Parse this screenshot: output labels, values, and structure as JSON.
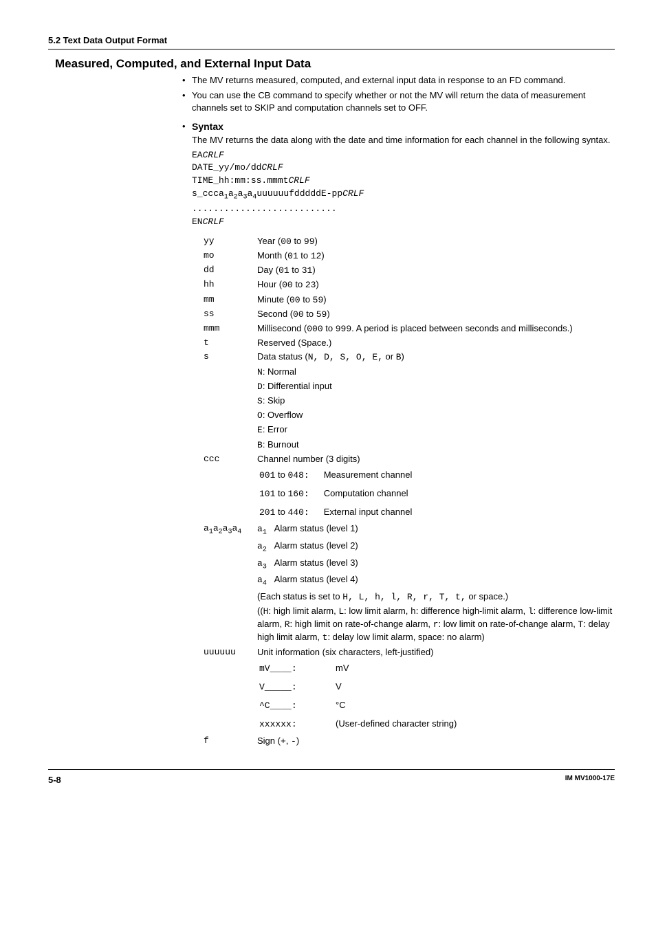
{
  "section_header": "5.2  Text Data Output Format",
  "subsection_title": "Measured, Computed, and External Input Data",
  "bullets": [
    "The MV returns measured, computed, and external input data in response to an FD command.",
    "You can use the CB command to specify whether or not the MV will return the data of measurement channels set to SKIP and computation channels set to OFF."
  ],
  "syntax": {
    "title": "Syntax",
    "intro": "The MV returns the data along with the date and time information for each channel in the following syntax.",
    "lines": {
      "l1a": "EA",
      "l1b": "CRLF",
      "l2a": "DATE_yy/mo/dd",
      "l2b": "CRLF",
      "l3a": "TIME_hh:mm:ss.mmmt",
      "l3b": "CRLF",
      "l4a": "s_ccca",
      "l4b": "a",
      "l4c": "a",
      "l4d": "a",
      "l4e": "uuuuuufdddddE-pp",
      "l4f": "CRLF",
      "l5": "...........................",
      "l6a": "EN",
      "l6b": "CRLF"
    }
  },
  "defs": {
    "yy": {
      "k": "yy",
      "pre": "Year (",
      "r0": "00",
      "mid": " to ",
      "r1": "99",
      "post": ")"
    },
    "mo": {
      "k": "mo",
      "pre": "Month (",
      "r0": "01",
      "mid": " to ",
      "r1": "12",
      "post": ")"
    },
    "dd": {
      "k": "dd",
      "pre": "Day (",
      "r0": "01",
      "mid": " to ",
      "r1": "31",
      "post": ")"
    },
    "hh": {
      "k": "hh",
      "pre": "Hour (",
      "r0": "00",
      "mid": " to ",
      "r1": "23",
      "post": ")"
    },
    "mm": {
      "k": "mm",
      "pre": "Minute (",
      "r0": "00",
      "mid": " to ",
      "r1": "59",
      "post": ")"
    },
    "ss": {
      "k": "ss",
      "pre": "Second (",
      "r0": "00",
      "mid": " to ",
      "r1": "59",
      "post": ")"
    },
    "mmm": {
      "k": "mmm",
      "pre": "Millisecond (",
      "r0": "000",
      "mid": " to ",
      "r1": "999",
      "post": ". A period is placed between seconds and milliseconds.)"
    },
    "t": {
      "k": "t",
      "text": "Reserved (Space.)"
    },
    "s": {
      "k": "s",
      "head_pre": "Data status (",
      "head_codes": "N, D, S, O, E,",
      "head_or": " or ",
      "head_last": "B",
      "head_post": ")",
      "n": {
        "c": "N",
        "t": ": Normal"
      },
      "d": {
        "c": "D",
        "t": ": Differential input"
      },
      "ss": {
        "c": "S",
        "t": ": Skip"
      },
      "o": {
        "c": "O",
        "t": ": Overflow"
      },
      "e": {
        "c": "E",
        "t": ": Error"
      },
      "b": {
        "c": "B",
        "t": ": Burnout"
      }
    },
    "ccc": {
      "k": "ccc",
      "head": "Channel number (3 digits)",
      "r1": {
        "a": "001",
        "mid": " to ",
        "b": "048",
        "colon": ":",
        "t": "Measurement channel"
      },
      "r2": {
        "a": "101",
        "mid": " to ",
        "b": "160",
        "colon": ":",
        "t": "Computation channel"
      },
      "r3": {
        "a": "201",
        "mid": " to ",
        "b": "440",
        "colon": ":",
        "t": "External input channel"
      }
    },
    "alarm": {
      "k_a": "a",
      "k_1": "1",
      "k_2": "2",
      "k_3": "3",
      "k_4": "4",
      "a1c": "a",
      "a1s": "1",
      "a1t": "Alarm status (level 1)",
      "a2c": "a",
      "a2s": "2",
      "a2t": "Alarm status (level 2)",
      "a3c": "a",
      "a3s": "3",
      "a3t": "Alarm status (level 3)",
      "a4c": "a",
      "a4s": "4",
      "a4t": "Alarm status (level 4)",
      "each_pre": "(Each status is set to ",
      "each_codes": "H, L, h, l, R, r, T, t,",
      "each_post": " or space.)",
      "expl_open": "((",
      "expl_H": "H",
      "expl_Ht": ": high limit alarm, ",
      "expl_L": "L",
      "expl_Lt": ": low limit alarm, ",
      "expl_h": "h",
      "expl_ht": ": difference high-limit alarm, ",
      "expl_l": "l",
      "expl_lt": ": difference low-limit alarm, ",
      "expl_R": "R",
      "expl_Rt": ": high limit on rate-of-change alarm, ",
      "expl_r": "r",
      "expl_rt": ": low limit on rate-of-change alarm, ",
      "expl_T": "T",
      "expl_Tt": ": delay high limit alarm, ",
      "expl_t": "t",
      "expl_tt": ": delay low limit alarm, space: no alarm)"
    },
    "uu": {
      "k": "uuuuuu",
      "head": "Unit information (six characters, left-justified)",
      "r1": {
        "c": "mV____",
        "colon": ":",
        "t": "mV"
      },
      "r2": {
        "c": "V_____",
        "colon": ":",
        "t": "V"
      },
      "r3": {
        "c": "^C____",
        "colon": ":",
        "t": "°C"
      },
      "r4": {
        "c": "xxxxxx",
        "colon": ":",
        "t": "(User-defined character string)"
      }
    },
    "f": {
      "k": "f",
      "pre": "Sign (",
      "p": "+",
      "sep": ", ",
      "m": "-",
      "post": ")"
    }
  },
  "footer": {
    "page": "5-8",
    "doc": "IM MV1000-17E"
  }
}
